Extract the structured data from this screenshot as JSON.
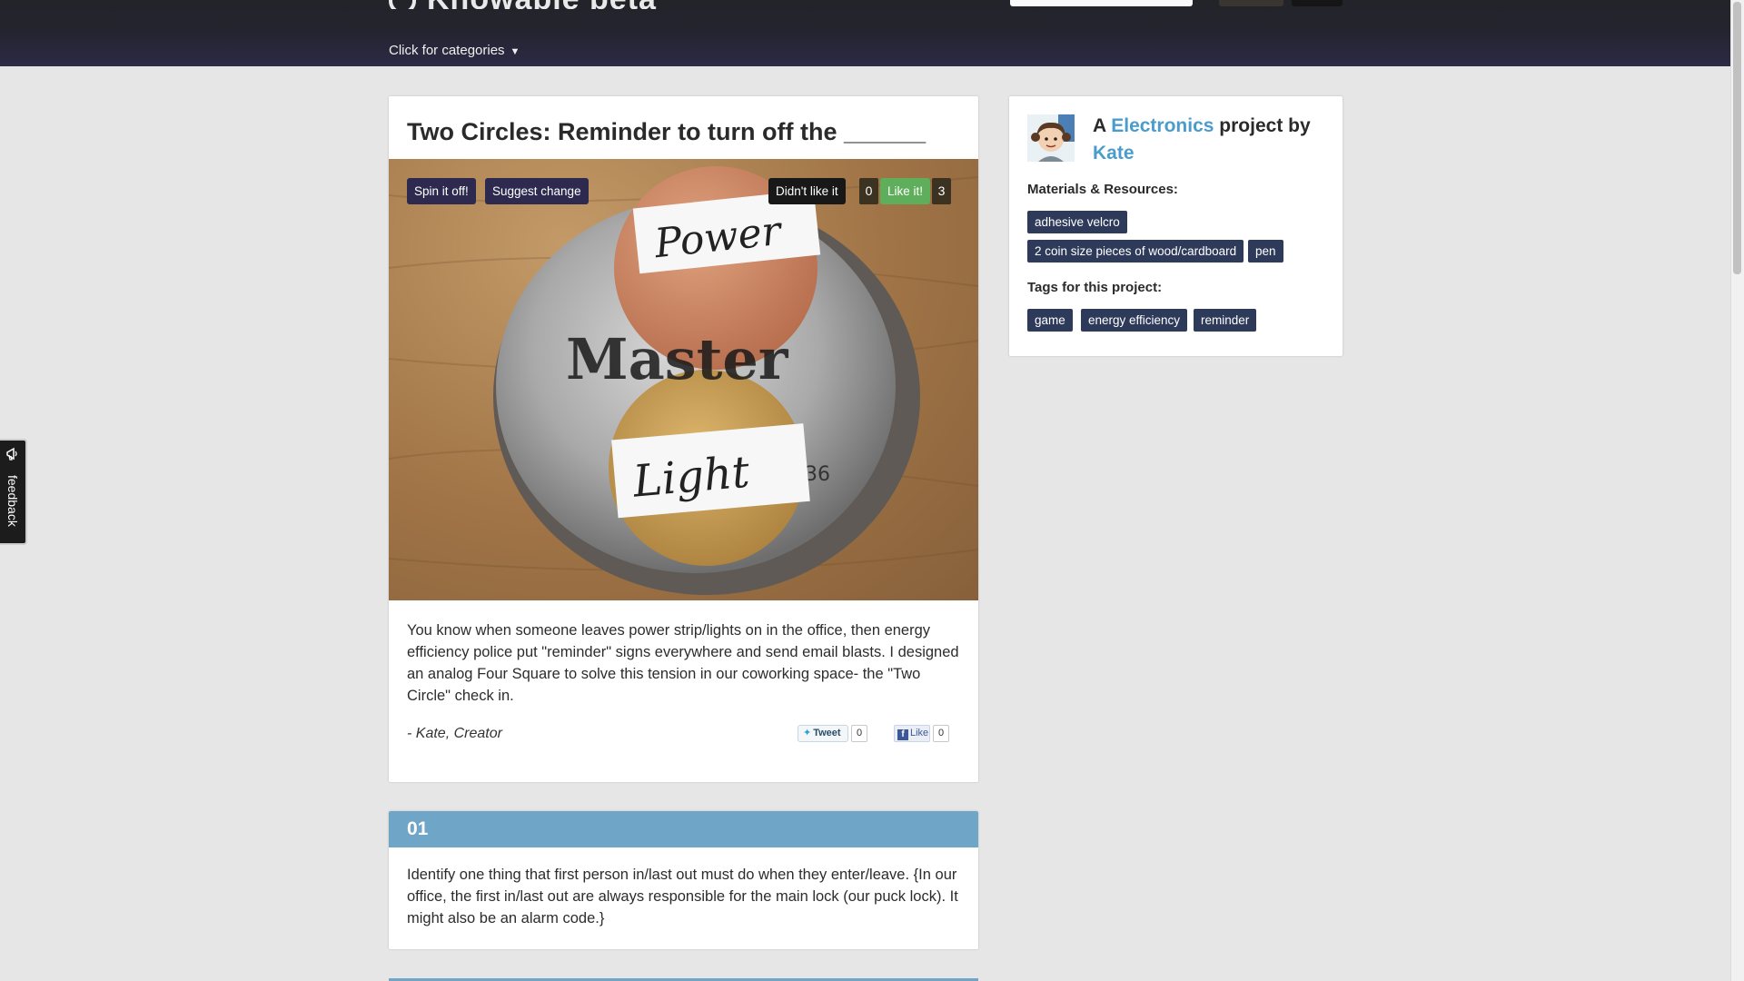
{
  "header": {
    "brand": "Knowable beta",
    "categories_label": "Click for categories",
    "categories_caret": "▼"
  },
  "feedback": {
    "label": "feedback",
    "icon": "megaphone-icon"
  },
  "project": {
    "title": "Two Circles: Reminder to turn off the ______",
    "actions": {
      "spin_off": "Spin it off!",
      "suggest_change": "Suggest change",
      "dislike": "Didn't like it",
      "dislike_count": "0",
      "like": "Like it!",
      "like_count": "3"
    },
    "image_labels": {
      "top": "Power",
      "bottom": "Light",
      "lock_brand": "Master",
      "lock_number": "36"
    },
    "description": "You know when someone leaves power strip/lights on in the office, then energy efficiency police put \"reminder\" signs everywhere and send email blasts. I designed an analog Four Square to solve this tension in our coworking space- the \"Two Circle\" check in.",
    "creator": "- Kate, Creator",
    "share": {
      "tweet_label": "Tweet",
      "tweet_count": "0",
      "fb_label": "Like",
      "fb_count": "0"
    }
  },
  "steps": [
    {
      "number": "01",
      "text": "Identify one thing that first person in/last out must do when they enter/leave. {In our office, the first in/last out are always responsible for the main lock (our puck lock). It might also be an alarm code.}"
    }
  ],
  "sidebar": {
    "prefix": "A",
    "category": "Electronics",
    "middle": "project by",
    "author": "Kate",
    "materials_heading": "Materials & Resources:",
    "materials": [
      "adhesive velcro",
      "2 coin size pieces of wood/cardboard",
      "pen"
    ],
    "tags_heading": "Tags for this project:",
    "tags": [
      "game",
      "energy efficiency",
      "reminder"
    ]
  },
  "colors": {
    "accent_purple": "#2e2a4f",
    "like_green": "#5fae5b",
    "link_blue": "#4b9ccc",
    "step_blue": "#6fa5c6",
    "chip_navy": "#2e3a5a"
  }
}
